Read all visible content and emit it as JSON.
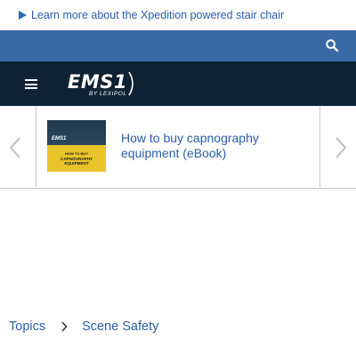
{
  "promo": {
    "link_text": "Learn more about the Xpedition powered stair chair"
  },
  "header": {
    "search_icon": "search-icon",
    "menu_icon": "hamburger-menu-icon",
    "logo": {
      "main": "EMS1",
      "sub": "BY LEXIPOL"
    }
  },
  "carousel": {
    "prev_icon": "chevron-left-icon",
    "next_icon": "chevron-right-icon",
    "slide": {
      "title": "How to buy capnography equipment (eBook)",
      "thumbnail": {
        "brand": "EMS1",
        "line1": "HOW TO BUY",
        "line2": "CAPNOGRAPHY",
        "line3": "EQUIPMENT"
      }
    }
  },
  "breadcrumb": {
    "items": [
      "Topics",
      "Scene Safety"
    ]
  },
  "colors": {
    "searchbar": "#3a6aa6",
    "navbar": "#0f2233",
    "link": "#2a5ea8",
    "thumb_band": "#e8c42a"
  }
}
